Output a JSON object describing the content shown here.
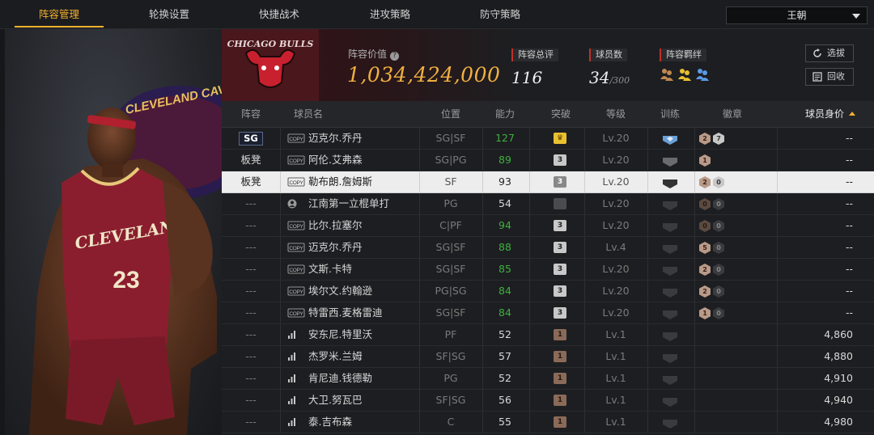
{
  "nav": {
    "tabs": [
      {
        "label": "阵容管理",
        "active": true
      },
      {
        "label": "轮换设置",
        "active": false
      },
      {
        "label": "快捷战术",
        "active": false
      },
      {
        "label": "进攻策略",
        "active": false
      },
      {
        "label": "防守策略",
        "active": false
      }
    ],
    "user": "王朝"
  },
  "art": {
    "team_logo_text": "CLEVELAND CAVALIERS",
    "jersey_text": "CLEVELAND",
    "jersey_number": "23"
  },
  "header": {
    "logo_text": "CHICAGO BULLS",
    "value_label": "阵容价值",
    "value": "1,034,424,000",
    "stats": [
      {
        "label": "阵容总评",
        "value": "116",
        "suffix": ""
      },
      {
        "label": "球员数",
        "value": "34",
        "suffix": "/300"
      },
      {
        "label": "阵容羁绊",
        "value": "",
        "suffix": ""
      }
    ],
    "buttons": [
      "选拔",
      "回收"
    ]
  },
  "table": {
    "columns": [
      "阵容",
      "球员名",
      "位置",
      "能力",
      "突破",
      "等级",
      "训练",
      "徽章",
      "球员身价"
    ],
    "sort_column": "球员身价",
    "rows": [
      {
        "slot": "SG",
        "name": "迈克尔.乔丹",
        "pos": "SG|SF",
        "power": "127",
        "green": true,
        "breakthrough": "crown",
        "level": "Lv.20",
        "train": "blue",
        "badges": [
          [
            "2",
            "bronze"
          ],
          [
            "7",
            "silver"
          ]
        ],
        "value": "--",
        "tag": "copy",
        "selected": false
      },
      {
        "slot": "板凳",
        "name": "阿伦.艾弗森",
        "pos": "SG|PG",
        "power": "89",
        "green": true,
        "breakthrough": "3",
        "level": "Lv.20",
        "train": "gray",
        "badges": [
          [
            "1",
            "bronze"
          ]
        ],
        "value": "--",
        "tag": "copy",
        "selected": false
      },
      {
        "slot": "板凳",
        "name": "勒布朗.詹姆斯",
        "pos": "SF",
        "power": "93",
        "green": false,
        "breakthrough": "3",
        "level": "Lv.20",
        "train": "dark",
        "badges": [
          [
            "2",
            "bronze"
          ],
          [
            "0",
            "silver"
          ]
        ],
        "value": "--",
        "tag": "copy",
        "selected": true
      },
      {
        "slot": "---",
        "name": "江南第一立棍单打",
        "pos": "PG",
        "power": "54",
        "green": false,
        "breakthrough": "none",
        "level": "Lv.20",
        "train": "dark",
        "badges": [
          [
            "0",
            "darkb"
          ],
          [
            "0",
            "dark"
          ]
        ],
        "value": "--",
        "tag": "person",
        "selected": false
      },
      {
        "slot": "---",
        "name": "比尔.拉塞尔",
        "pos": "C|PF",
        "power": "94",
        "green": true,
        "breakthrough": "3",
        "level": "Lv.20",
        "train": "dark",
        "badges": [
          [
            "0",
            "darkb"
          ],
          [
            "0",
            "dark"
          ]
        ],
        "value": "--",
        "tag": "copy",
        "selected": false
      },
      {
        "slot": "---",
        "name": "迈克尔.乔丹",
        "pos": "SG|SF",
        "power": "88",
        "green": true,
        "breakthrough": "3",
        "level": "Lv.4",
        "train": "dark",
        "badges": [
          [
            "5",
            "bronze"
          ],
          [
            "0",
            "dark"
          ]
        ],
        "value": "--",
        "tag": "copy",
        "selected": false
      },
      {
        "slot": "---",
        "name": "文斯.卡特",
        "pos": "SG|SF",
        "power": "85",
        "green": true,
        "breakthrough": "3",
        "level": "Lv.20",
        "train": "dark",
        "badges": [
          [
            "2",
            "bronze"
          ],
          [
            "0",
            "dark"
          ]
        ],
        "value": "--",
        "tag": "copy",
        "selected": false
      },
      {
        "slot": "---",
        "name": "埃尔文.约翰逊",
        "pos": "PG|SG",
        "power": "84",
        "green": true,
        "breakthrough": "3",
        "level": "Lv.20",
        "train": "dark",
        "badges": [
          [
            "2",
            "bronze"
          ],
          [
            "0",
            "dark"
          ]
        ],
        "value": "--",
        "tag": "copy",
        "selected": false
      },
      {
        "slot": "---",
        "name": "特雷西.麦格雷迪",
        "pos": "SG|SF",
        "power": "84",
        "green": true,
        "breakthrough": "3",
        "level": "Lv.20",
        "train": "dark",
        "badges": [
          [
            "1",
            "bronze"
          ],
          [
            "0",
            "dark"
          ]
        ],
        "value": "--",
        "tag": "copy",
        "selected": false
      },
      {
        "slot": "---",
        "name": "安东尼.特里沃",
        "pos": "PF",
        "power": "52",
        "green": false,
        "breakthrough": "1",
        "level": "Lv.1",
        "train": "dark",
        "badges": [],
        "value": "4,860",
        "tag": "bars",
        "selected": false
      },
      {
        "slot": "---",
        "name": "杰罗米.兰姆",
        "pos": "SF|SG",
        "power": "57",
        "green": false,
        "breakthrough": "1",
        "level": "Lv.1",
        "train": "dark",
        "badges": [],
        "value": "4,880",
        "tag": "bars",
        "selected": false
      },
      {
        "slot": "---",
        "name": "肯尼迪.钱德勒",
        "pos": "PG",
        "power": "52",
        "green": false,
        "breakthrough": "1",
        "level": "Lv.1",
        "train": "dark",
        "badges": [],
        "value": "4,910",
        "tag": "bars",
        "selected": false
      },
      {
        "slot": "---",
        "name": "大卫.努瓦巴",
        "pos": "SF|SG",
        "power": "56",
        "green": false,
        "breakthrough": "1",
        "level": "Lv.1",
        "train": "dark",
        "badges": [],
        "value": "4,940",
        "tag": "bars",
        "selected": false
      },
      {
        "slot": "---",
        "name": "泰.吉布森",
        "pos": "C",
        "power": "55",
        "green": false,
        "breakthrough": "1",
        "level": "Lv.1",
        "train": "dark",
        "badges": [],
        "value": "4,980",
        "tag": "bars",
        "selected": false
      }
    ]
  },
  "colors": {
    "accent": "#f0b030",
    "value_gold": "#f0b040",
    "power_green": "#3eb03e",
    "bulls_red": "#4a171c"
  }
}
